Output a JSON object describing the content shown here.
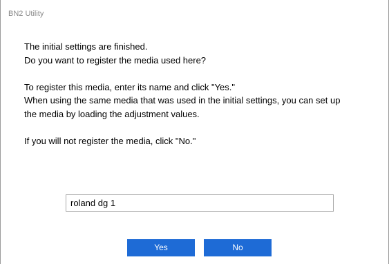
{
  "window": {
    "title": "BN2 Utility"
  },
  "message": {
    "line1": "The initial settings are finished.",
    "line2": "Do you want to register the media used here?",
    "line3": "To register this media, enter its name and click \"Yes.\"",
    "line4": "When using the same media that was used in the initial settings, you can set up",
    "line5": "the media by loading the adjustment values.",
    "line6": "If you will not register the media, click \"No.\""
  },
  "media_name_input": {
    "value": "roland dg 1"
  },
  "buttons": {
    "yes_label": "Yes",
    "no_label": "No"
  },
  "colors": {
    "button_bg": "#1e6bd6",
    "button_text": "#ffffff",
    "title_text": "#8a8a8a"
  }
}
